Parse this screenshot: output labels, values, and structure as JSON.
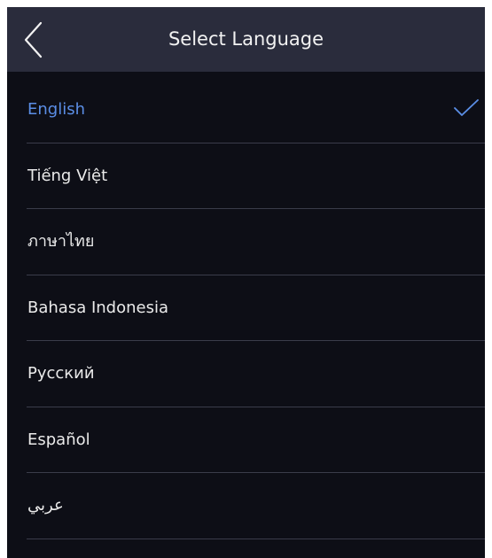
{
  "header": {
    "title": "Select Language",
    "back_icon": "chevron-left-icon"
  },
  "languages": {
    "items": [
      {
        "label": "English",
        "selected": true
      },
      {
        "label": "Tiếng Việt",
        "selected": false
      },
      {
        "label": "ภาษาไทย",
        "selected": false
      },
      {
        "label": "Bahasa Indonesia",
        "selected": false
      },
      {
        "label": "Русский",
        "selected": false
      },
      {
        "label": "Español",
        "selected": false
      },
      {
        "label": "عربي",
        "selected": false
      }
    ],
    "selected_icon": "checkmark-icon"
  },
  "colors": {
    "background": "#0d0e16",
    "header_background": "#2a2c3c",
    "accent": "#5b8ee6",
    "text": "#eaeaea",
    "divider": "#3a3c4a"
  }
}
